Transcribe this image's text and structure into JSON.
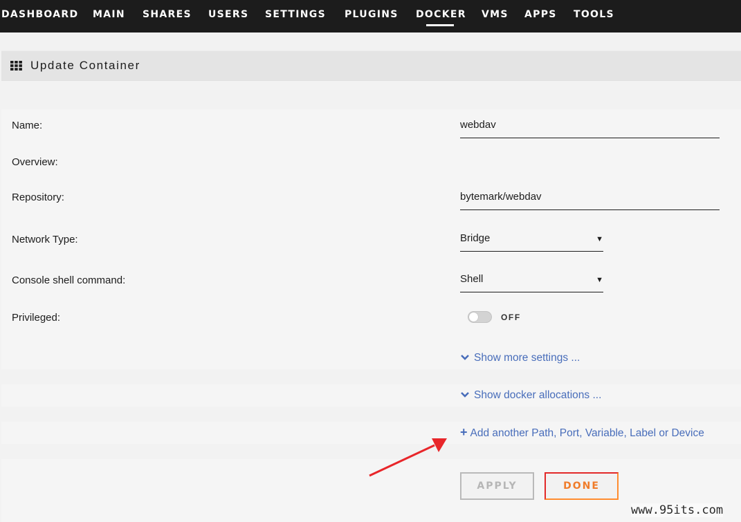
{
  "nav": {
    "items": [
      "DASHBOARD",
      "MAIN",
      "SHARES",
      "USERS",
      "SETTINGS",
      "PLUGINS",
      "DOCKER",
      "VMS",
      "APPS",
      "TOOLS"
    ],
    "active": "DOCKER"
  },
  "page": {
    "title": "Update Container",
    "title_icon": "grid-icon"
  },
  "form": {
    "name_label": "Name:",
    "name_value": "webdav",
    "overview_label": "Overview:",
    "repository_label": "Repository:",
    "repository_value": "bytemark/webdav",
    "network_label": "Network Type:",
    "network_value": "Bridge",
    "console_label": "Console shell command:",
    "console_value": "Shell",
    "privileged_label": "Privileged:",
    "privileged_state": "OFF"
  },
  "links": {
    "more_settings": "Show more settings ...",
    "docker_allocations": "Show docker allocations ...",
    "add_another": "Add another Path, Port, Variable, Label or Device"
  },
  "buttons": {
    "apply": "APPLY",
    "done": "DONE"
  },
  "watermark": "www.95its.com",
  "colors": {
    "nav_bg": "#1c1c1c",
    "link": "#486dba",
    "done_border": "#ff8c2f",
    "annotation_arrow": "#e8262a"
  }
}
